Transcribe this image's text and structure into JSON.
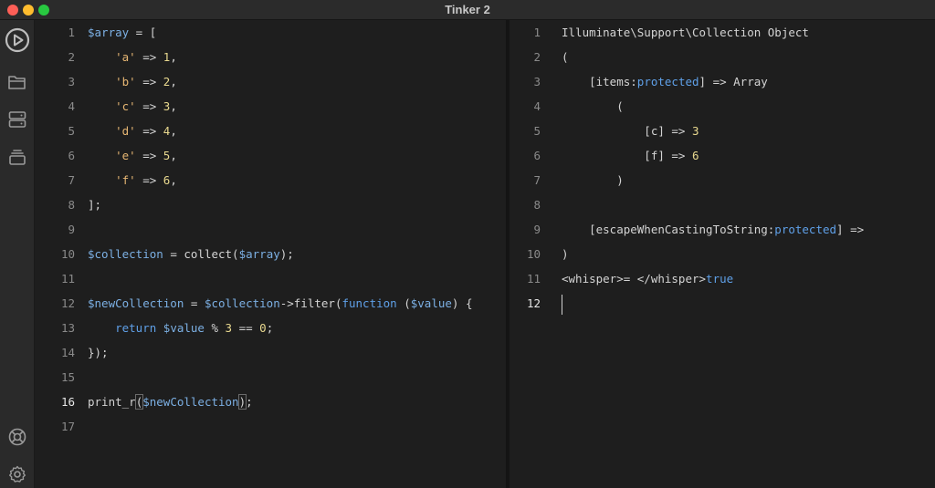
{
  "window": {
    "title": "Tinker 2"
  },
  "sidebar": {
    "top_icons": [
      "play-circle-icon",
      "folder-icon",
      "server-icon",
      "stack-icon"
    ],
    "bottom_icons": [
      "lifebuoy-icon",
      "gear-icon"
    ]
  },
  "editor": {
    "active_line": 16,
    "lines": [
      {
        "n": "1",
        "t": [
          [
            "var",
            "$array"
          ],
          [
            "p",
            " = ["
          ]
        ]
      },
      {
        "n": "2",
        "t": [
          [
            "p",
            "    "
          ],
          [
            "str",
            "'a'"
          ],
          [
            "p",
            " => "
          ],
          [
            "num",
            "1"
          ],
          [
            "p",
            ","
          ]
        ]
      },
      {
        "n": "3",
        "t": [
          [
            "p",
            "    "
          ],
          [
            "str",
            "'b'"
          ],
          [
            "p",
            " => "
          ],
          [
            "num",
            "2"
          ],
          [
            "p",
            ","
          ]
        ]
      },
      {
        "n": "4",
        "t": [
          [
            "p",
            "    "
          ],
          [
            "str",
            "'c'"
          ],
          [
            "p",
            " => "
          ],
          [
            "num",
            "3"
          ],
          [
            "p",
            ","
          ]
        ]
      },
      {
        "n": "5",
        "t": [
          [
            "p",
            "    "
          ],
          [
            "str",
            "'d'"
          ],
          [
            "p",
            " => "
          ],
          [
            "num",
            "4"
          ],
          [
            "p",
            ","
          ]
        ]
      },
      {
        "n": "6",
        "t": [
          [
            "p",
            "    "
          ],
          [
            "str",
            "'e'"
          ],
          [
            "p",
            " => "
          ],
          [
            "num",
            "5"
          ],
          [
            "p",
            ","
          ]
        ]
      },
      {
        "n": "7",
        "t": [
          [
            "p",
            "    "
          ],
          [
            "str",
            "'f'"
          ],
          [
            "p",
            " => "
          ],
          [
            "num",
            "6"
          ],
          [
            "p",
            ","
          ]
        ]
      },
      {
        "n": "8",
        "t": [
          [
            "p",
            "];"
          ]
        ]
      },
      {
        "n": "9",
        "t": []
      },
      {
        "n": "10",
        "t": [
          [
            "var",
            "$collection"
          ],
          [
            "p",
            " = collect("
          ],
          [
            "var",
            "$array"
          ],
          [
            "p",
            ");"
          ]
        ]
      },
      {
        "n": "11",
        "t": []
      },
      {
        "n": "12",
        "t": [
          [
            "var",
            "$newCollection"
          ],
          [
            "p",
            " = "
          ],
          [
            "var",
            "$collection"
          ],
          [
            "p",
            "->filter("
          ],
          [
            "kw",
            "function"
          ],
          [
            "p",
            " ("
          ],
          [
            "var",
            "$value"
          ],
          [
            "p",
            ") {"
          ]
        ]
      },
      {
        "n": "13",
        "t": [
          [
            "p",
            "    "
          ],
          [
            "kw",
            "return"
          ],
          [
            "p",
            " "
          ],
          [
            "var",
            "$value"
          ],
          [
            "p",
            " % "
          ],
          [
            "num",
            "3"
          ],
          [
            "p",
            " == "
          ],
          [
            "num",
            "0"
          ],
          [
            "p",
            ";"
          ]
        ]
      },
      {
        "n": "14",
        "t": [
          [
            "p",
            "});"
          ]
        ]
      },
      {
        "n": "15",
        "t": []
      },
      {
        "n": "16",
        "t": [
          [
            "p",
            "print_r"
          ],
          [
            "bm",
            "("
          ],
          [
            "var",
            "$newCollection"
          ],
          [
            "bm",
            ")"
          ],
          [
            "p",
            ";"
          ]
        ]
      },
      {
        "n": "17",
        "t": []
      }
    ]
  },
  "output": {
    "active_line": 12,
    "lines": [
      {
        "n": "1",
        "t": [
          [
            "p",
            "Illuminate\\Support\\Collection Object"
          ]
        ]
      },
      {
        "n": "2",
        "t": [
          [
            "p",
            "("
          ]
        ]
      },
      {
        "n": "3",
        "t": [
          [
            "p",
            "    [items:"
          ],
          [
            "prot",
            "protected"
          ],
          [
            "p",
            "] => Array"
          ]
        ]
      },
      {
        "n": "4",
        "t": [
          [
            "p",
            "        ("
          ]
        ]
      },
      {
        "n": "5",
        "t": [
          [
            "p",
            "            [c] => "
          ],
          [
            "num",
            "3"
          ]
        ]
      },
      {
        "n": "6",
        "t": [
          [
            "p",
            "            [f] => "
          ],
          [
            "num",
            "6"
          ]
        ]
      },
      {
        "n": "7",
        "t": [
          [
            "p",
            "        )"
          ]
        ]
      },
      {
        "n": "8",
        "t": []
      },
      {
        "n": "9",
        "t": [
          [
            "p",
            "    [escapeWhenCastingToString:"
          ],
          [
            "prot",
            "protected"
          ],
          [
            "p",
            "] =>"
          ]
        ]
      },
      {
        "n": "10",
        "t": [
          [
            "p",
            ")"
          ]
        ]
      },
      {
        "n": "11",
        "t": [
          [
            "p",
            "<whisper>= </whisper>"
          ],
          [
            "kw",
            "true"
          ]
        ]
      },
      {
        "n": "12",
        "t": []
      }
    ]
  }
}
